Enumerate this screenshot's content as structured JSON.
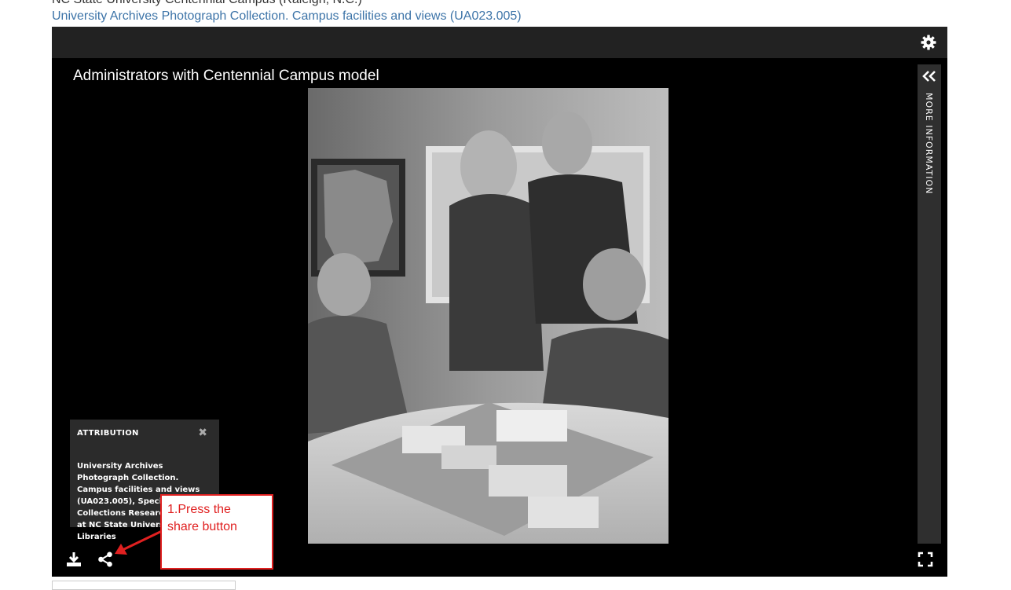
{
  "page": {
    "breadcrumb_top": "NC State University Centennial Campus (Raleigh, N.C.)",
    "collection_link": "University Archives Photograph Collection. Campus facilities and views (UA023.005)"
  },
  "viewer": {
    "title": "Administrators with Centennial Campus model",
    "more_info_label": "MORE INFORMATION",
    "attribution": {
      "title": "ATTRIBUTION",
      "close": "✖",
      "text": "University Archives Photograph Collection. Campus facilities and views (UA023.005), Special Collections Research Center at NC State University Libraries"
    },
    "icons": {
      "settings": "gear-icon",
      "download": "download-icon",
      "share": "share-icon",
      "fullscreen": "fullscreen-icon",
      "more_info": "double-chevron-left-icon"
    }
  },
  "annotation": {
    "callout_line1": "1.Press the",
    "callout_line2": "share button",
    "color": "#e02020"
  },
  "colors": {
    "link": "#3d74a8",
    "viewer_bg": "#000000",
    "header_bg": "#222222",
    "panel_bg": "#2b2b2b"
  }
}
